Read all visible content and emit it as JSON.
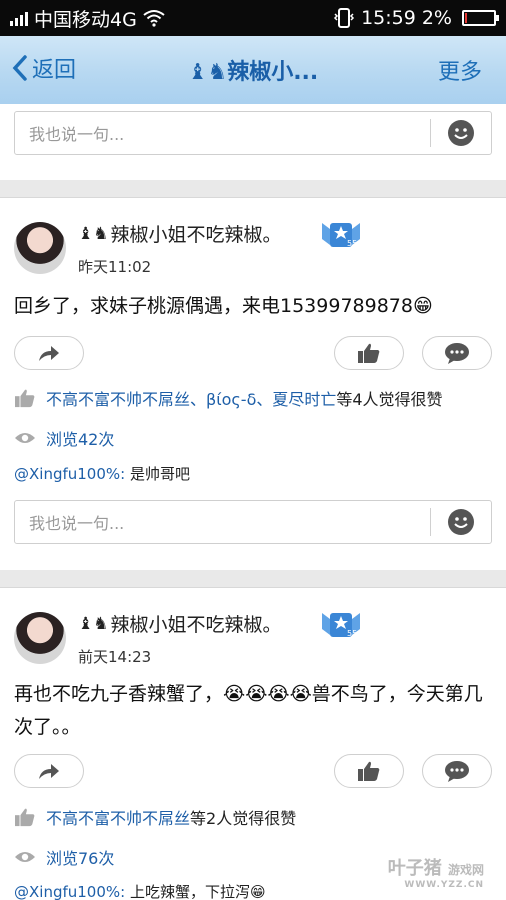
{
  "status_bar": {
    "carrier": "中国移动4G",
    "time": "15:59",
    "battery": "2%",
    "battery_level": 0.02
  },
  "header": {
    "back_label": "返回",
    "title": "辣椒小...",
    "more_label": "更多"
  },
  "comment_placeholder": "我也说一句...",
  "posts": [
    {
      "username": "辣椒小姐不吃辣椒。",
      "level_badge": "55",
      "time": "昨天11:02",
      "text": "回乡了，求妹子桃源偶遇，来电15399789878😁",
      "likers": "不高不富不帅不屌丝、βίος-δ、夏尽时亡",
      "likes_suffix": "等4人觉得很赞",
      "views": "浏览42次",
      "reply_user": "@Xingfu100%:",
      "reply_text": " 是帅哥吧"
    },
    {
      "username": "辣椒小姐不吃辣椒。",
      "level_badge": "55",
      "time": "前天14:23",
      "text": "再也不吃九子香辣蟹了，😭😭😭😭兽不鸟了，今天第几次了。。",
      "likers": "不高不富不帅不屌丝",
      "likes_suffix": "等2人觉得很赞",
      "views": "浏览76次",
      "reply_user": "@Xingfu100%:",
      "reply_text": " 上吃辣蟹，下拉泻😁"
    }
  ],
  "watermark": {
    "brand": "叶子猪",
    "sub": "游戏网",
    "url": "WWW.YZZ.CN"
  },
  "colors": {
    "link_blue": "#1e5fa8",
    "header_blue": "#b7d8f1"
  }
}
